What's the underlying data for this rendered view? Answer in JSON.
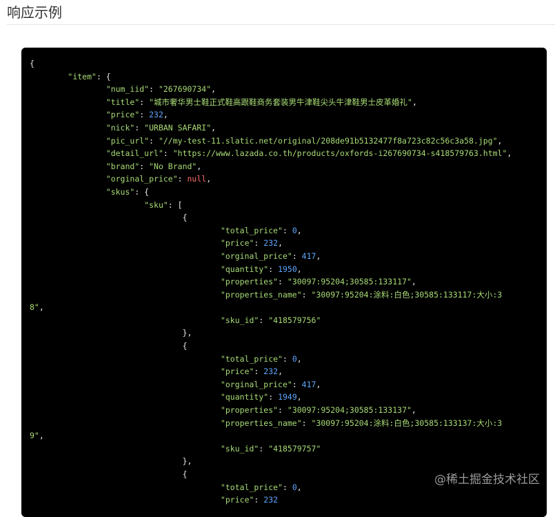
{
  "page": {
    "section_title": "响应示例",
    "watermark": "@稀土掘金技术社区"
  },
  "code_lines": [
    [
      {
        "t": "p",
        "v": "{"
      }
    ],
    [
      {
        "t": "p",
        "v": "\t"
      },
      {
        "t": "k",
        "v": "\"item\""
      },
      {
        "t": "p",
        "v": ": {"
      }
    ],
    [
      {
        "t": "p",
        "v": "\t\t"
      },
      {
        "t": "k",
        "v": "\"num_iid\""
      },
      {
        "t": "p",
        "v": ": "
      },
      {
        "t": "s",
        "v": "\"267690734\""
      },
      {
        "t": "p",
        "v": ","
      }
    ],
    [
      {
        "t": "p",
        "v": "\t\t"
      },
      {
        "t": "k",
        "v": "\"title\""
      },
      {
        "t": "p",
        "v": ": "
      },
      {
        "t": "s",
        "v": "\"城市奢华男士鞋正式鞋高跟鞋商务套装男牛津鞋尖头牛津鞋男士皮革婚礼\""
      },
      {
        "t": "p",
        "v": ","
      }
    ],
    [
      {
        "t": "p",
        "v": "\t\t"
      },
      {
        "t": "k",
        "v": "\"price\""
      },
      {
        "t": "p",
        "v": ": "
      },
      {
        "t": "n",
        "v": "232"
      },
      {
        "t": "p",
        "v": ","
      }
    ],
    [
      {
        "t": "p",
        "v": "\t\t"
      },
      {
        "t": "k",
        "v": "\"nick\""
      },
      {
        "t": "p",
        "v": ": "
      },
      {
        "t": "s",
        "v": "\"URBAN SAFARI\""
      },
      {
        "t": "p",
        "v": ","
      }
    ],
    [
      {
        "t": "p",
        "v": "\t\t"
      },
      {
        "t": "k",
        "v": "\"pic_url\""
      },
      {
        "t": "p",
        "v": ": "
      },
      {
        "t": "s",
        "v": "\"//my-test-11.slatic.net/original/208de91b5132477f8a723c82c56c3a58.jpg\""
      },
      {
        "t": "p",
        "v": ","
      }
    ],
    [
      {
        "t": "p",
        "v": "\t\t"
      },
      {
        "t": "k",
        "v": "\"detail_url\""
      },
      {
        "t": "p",
        "v": ": "
      },
      {
        "t": "s",
        "v": "\"https://www.lazada.co.th/products/oxfords-i267690734-s418579763.html\""
      },
      {
        "t": "p",
        "v": ","
      }
    ],
    [
      {
        "t": "p",
        "v": "\t\t"
      },
      {
        "t": "k",
        "v": "\"brand\""
      },
      {
        "t": "p",
        "v": ": "
      },
      {
        "t": "s",
        "v": "\"No Brand\""
      },
      {
        "t": "p",
        "v": ","
      }
    ],
    [
      {
        "t": "p",
        "v": "\t\t"
      },
      {
        "t": "k",
        "v": "\"orginal_price\""
      },
      {
        "t": "p",
        "v": ": "
      },
      {
        "t": "nl",
        "v": "null"
      },
      {
        "t": "p",
        "v": ","
      }
    ],
    [
      {
        "t": "p",
        "v": "\t\t"
      },
      {
        "t": "k",
        "v": "\"skus\""
      },
      {
        "t": "p",
        "v": ": {"
      }
    ],
    [
      {
        "t": "p",
        "v": "\t\t\t"
      },
      {
        "t": "k",
        "v": "\"sku\""
      },
      {
        "t": "p",
        "v": ": ["
      }
    ],
    [
      {
        "t": "p",
        "v": "\t\t\t\t{"
      }
    ],
    [
      {
        "t": "p",
        "v": "\t\t\t\t\t"
      },
      {
        "t": "k",
        "v": "\"total_price\""
      },
      {
        "t": "p",
        "v": ": "
      },
      {
        "t": "n",
        "v": "0"
      },
      {
        "t": "p",
        "v": ","
      }
    ],
    [
      {
        "t": "p",
        "v": "\t\t\t\t\t"
      },
      {
        "t": "k",
        "v": "\"price\""
      },
      {
        "t": "p",
        "v": ": "
      },
      {
        "t": "n",
        "v": "232"
      },
      {
        "t": "p",
        "v": ","
      }
    ],
    [
      {
        "t": "p",
        "v": "\t\t\t\t\t"
      },
      {
        "t": "k",
        "v": "\"orginal_price\""
      },
      {
        "t": "p",
        "v": ": "
      },
      {
        "t": "n",
        "v": "417"
      },
      {
        "t": "p",
        "v": ","
      }
    ],
    [
      {
        "t": "p",
        "v": "\t\t\t\t\t"
      },
      {
        "t": "k",
        "v": "\"quantity\""
      },
      {
        "t": "p",
        "v": ": "
      },
      {
        "t": "n",
        "v": "1950"
      },
      {
        "t": "p",
        "v": ","
      }
    ],
    [
      {
        "t": "p",
        "v": "\t\t\t\t\t"
      },
      {
        "t": "k",
        "v": "\"properties\""
      },
      {
        "t": "p",
        "v": ": "
      },
      {
        "t": "s",
        "v": "\"30097:95204;30585:133117\""
      },
      {
        "t": "p",
        "v": ","
      }
    ],
    [
      {
        "t": "p",
        "v": "\t\t\t\t\t"
      },
      {
        "t": "k",
        "v": "\"properties_name\""
      },
      {
        "t": "p",
        "v": ": "
      },
      {
        "t": "s",
        "v": "\"30097:95204:涂料:白色;30585:133117:大小:3"
      }
    ],
    [
      {
        "t": "s",
        "v": "8\""
      },
      {
        "t": "p",
        "v": ","
      }
    ],
    [
      {
        "t": "p",
        "v": "\t\t\t\t\t"
      },
      {
        "t": "k",
        "v": "\"sku_id\""
      },
      {
        "t": "p",
        "v": ": "
      },
      {
        "t": "s",
        "v": "\"418579756\""
      }
    ],
    [
      {
        "t": "p",
        "v": "\t\t\t\t},"
      }
    ],
    [
      {
        "t": "p",
        "v": "\t\t\t\t{"
      }
    ],
    [
      {
        "t": "p",
        "v": "\t\t\t\t\t"
      },
      {
        "t": "k",
        "v": "\"total_price\""
      },
      {
        "t": "p",
        "v": ": "
      },
      {
        "t": "n",
        "v": "0"
      },
      {
        "t": "p",
        "v": ","
      }
    ],
    [
      {
        "t": "p",
        "v": "\t\t\t\t\t"
      },
      {
        "t": "k",
        "v": "\"price\""
      },
      {
        "t": "p",
        "v": ": "
      },
      {
        "t": "n",
        "v": "232"
      },
      {
        "t": "p",
        "v": ","
      }
    ],
    [
      {
        "t": "p",
        "v": "\t\t\t\t\t"
      },
      {
        "t": "k",
        "v": "\"orginal_price\""
      },
      {
        "t": "p",
        "v": ": "
      },
      {
        "t": "n",
        "v": "417"
      },
      {
        "t": "p",
        "v": ","
      }
    ],
    [
      {
        "t": "p",
        "v": "\t\t\t\t\t"
      },
      {
        "t": "k",
        "v": "\"quantity\""
      },
      {
        "t": "p",
        "v": ": "
      },
      {
        "t": "n",
        "v": "1949"
      },
      {
        "t": "p",
        "v": ","
      }
    ],
    [
      {
        "t": "p",
        "v": "\t\t\t\t\t"
      },
      {
        "t": "k",
        "v": "\"properties\""
      },
      {
        "t": "p",
        "v": ": "
      },
      {
        "t": "s",
        "v": "\"30097:95204;30585:133137\""
      },
      {
        "t": "p",
        "v": ","
      }
    ],
    [
      {
        "t": "p",
        "v": "\t\t\t\t\t"
      },
      {
        "t": "k",
        "v": "\"properties_name\""
      },
      {
        "t": "p",
        "v": ": "
      },
      {
        "t": "s",
        "v": "\"30097:95204:涂料:白色;30585:133137:大小:3"
      }
    ],
    [
      {
        "t": "s",
        "v": "9\""
      },
      {
        "t": "p",
        "v": ","
      }
    ],
    [
      {
        "t": "p",
        "v": "\t\t\t\t\t"
      },
      {
        "t": "k",
        "v": "\"sku_id\""
      },
      {
        "t": "p",
        "v": ": "
      },
      {
        "t": "s",
        "v": "\"418579757\""
      }
    ],
    [
      {
        "t": "p",
        "v": "\t\t\t\t},"
      }
    ],
    [
      {
        "t": "p",
        "v": "\t\t\t\t{"
      }
    ],
    [
      {
        "t": "p",
        "v": "\t\t\t\t\t"
      },
      {
        "t": "k",
        "v": "\"total_price\""
      },
      {
        "t": "p",
        "v": ": "
      },
      {
        "t": "n",
        "v": "0"
      },
      {
        "t": "p",
        "v": ","
      }
    ],
    [
      {
        "t": "p",
        "v": "\t\t\t\t\t"
      },
      {
        "t": "k",
        "v": "\"price\""
      },
      {
        "t": "p",
        "v": ": "
      },
      {
        "t": "n",
        "v": "232"
      }
    ]
  ]
}
